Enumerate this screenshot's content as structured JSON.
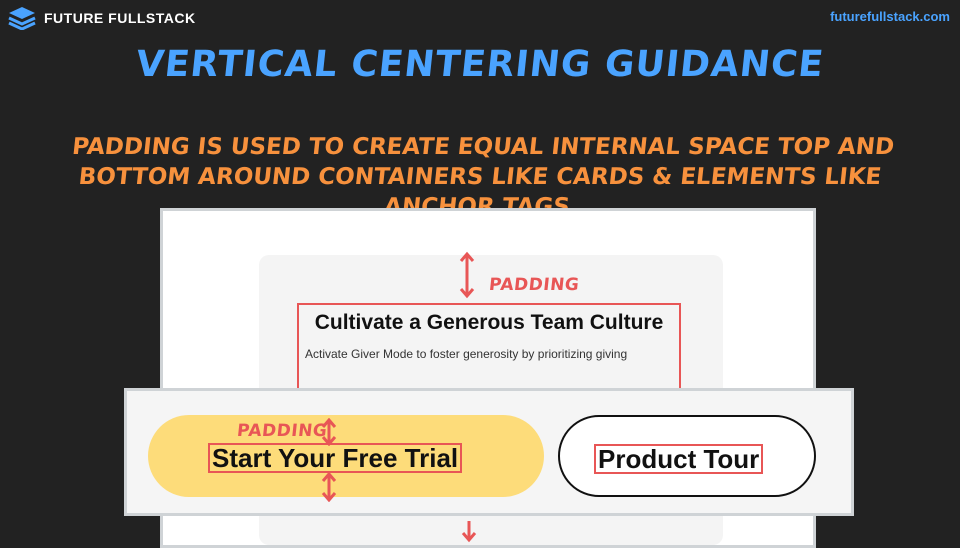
{
  "brand": {
    "name": "FUTURE FULLSTACK",
    "logo_icon": "stacked-layers-icon",
    "logo_color": "#4aa3ff"
  },
  "site_url": "futurefullstack.com",
  "title": "VERTICAL CENTERING GUIDANCE",
  "subtitle": "PADDING IS USED TO CREATE EQUAL INTERNAL SPACE TOP AND BOTTOM AROUND CONTAINERS LIKE CARDS & ELEMENTS LIKE ANCHOR TAGS",
  "card": {
    "padding_label": "PADDING",
    "title": "Cultivate a Generous Team Culture",
    "text": "Activate Giver Mode to foster generosity by prioritizing giving"
  },
  "buttons": {
    "padding_label": "PADDING",
    "primary_label": "Start Your Free Trial",
    "secondary_label": "Product Tour"
  },
  "colors": {
    "background": "#222222",
    "title": "#4aa3ff",
    "subtitle": "#f7913d",
    "annotation": "#e85656",
    "primary_button": "#fddc7a"
  }
}
